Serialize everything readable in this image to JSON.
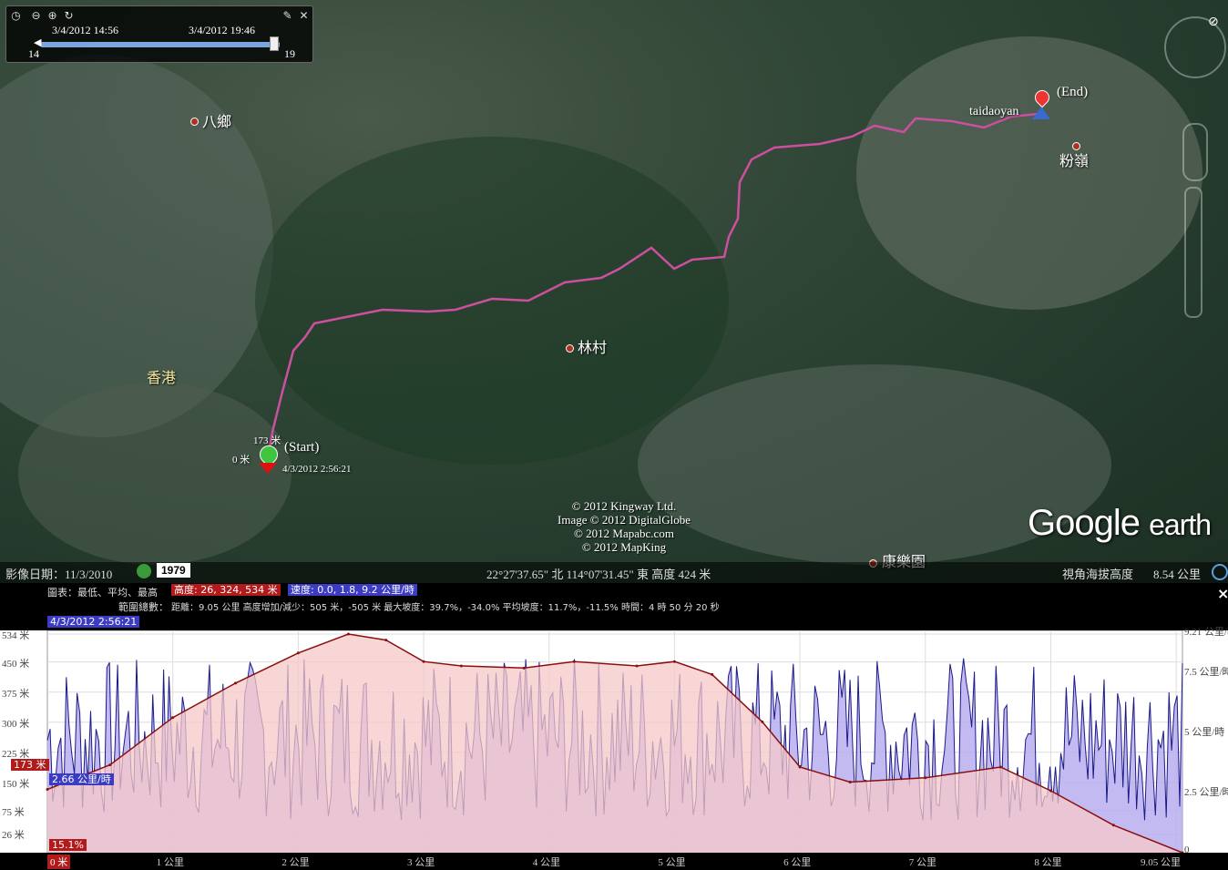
{
  "time_slider": {
    "start_label": "3/4/2012  14:56",
    "end_label": "3/4/2012  19:46",
    "min_hour": "14",
    "max_hour": "19"
  },
  "map": {
    "places": [
      "八鄉",
      "林村",
      "香港",
      "粉嶺",
      "康樂園"
    ],
    "track_start_label": "(Start)",
    "track_end_label": "(End)",
    "end_name": "taidaoyan",
    "start_altitude": "173 米",
    "start_ground": "0 米",
    "start_time": "4/3/2012 2:56:21",
    "copyright": [
      "© 2012 Kingway Ltd.",
      "Image © 2012 DigitalGlobe",
      "© 2012 Mapabc.com",
      "© 2012 MapKing"
    ],
    "logo_google": "Google",
    "logo_earth": "earth"
  },
  "status": {
    "imagery_date": "影像日期：11/3/2010",
    "year": "1979",
    "coords": "22°27'37.65\" 北  114°07'31.45\" 東 高度   424 米",
    "eye_alt_label": "視角海拔高度",
    "eye_alt_value": "8.54 公里"
  },
  "profile": {
    "legend_title": "圖表：最低、平均、最高",
    "elev_badge": "高度: 26, 324, 534 米",
    "speed_badge": "速度: 0.0, 1.8, 9.2 公里/時",
    "range_label": "範圍總數：",
    "range_stats": "距離：9.05 公里 高度增加/減少：505 米，-505 米  最大坡度：39.7%，-34.0%  平均坡度：11.7%，-11.5%  時間：4 時 50 分 20 秒",
    "cursor_time": "4/3/2012 2:56:21",
    "cursor_elev": "173 米",
    "cursor_speed": "2.66 公里/時",
    "cursor_slope": "15.1%",
    "close": "×",
    "y_left_ticks": [
      "534 米",
      "450 米",
      "375 米",
      "300 米",
      "225 米",
      "150 米",
      "75 米",
      "26 米"
    ],
    "y_right_ticks": [
      "9.21 公里/時",
      "7.5 公里/時",
      "5 公里/時",
      "2.5 公里/時",
      "0"
    ],
    "x_ticks": [
      "0 米",
      "1 公里",
      "2 公里",
      "3 公里",
      "4 公里",
      "5 公里",
      "6 公里",
      "7 公里",
      "8 公里",
      "9.05 公里"
    ]
  },
  "chart_data": {
    "type": "area",
    "series": [
      {
        "name": "高度",
        "x_km": [
          0,
          0.5,
          1.0,
          1.5,
          2.0,
          2.4,
          2.7,
          3.0,
          3.3,
          3.8,
          4.2,
          4.7,
          5.0,
          5.3,
          5.7,
          6.0,
          6.4,
          7.0,
          7.6,
          8.0,
          8.5,
          9.05
        ],
        "values": [
          173,
          230,
          340,
          420,
          490,
          534,
          520,
          470,
          460,
          455,
          470,
          460,
          470,
          440,
          330,
          225,
          190,
          200,
          225,
          170,
          90,
          26
        ]
      },
      {
        "name": "速度",
        "unit": "公里/時",
        "range": [
          0.0,
          9.2
        ]
      }
    ],
    "xlabel": "",
    "ylabel": "",
    "ylim_elev": [
      26,
      534
    ],
    "ylim_speed": [
      0,
      9.21
    ],
    "xlim": [
      0,
      9.05
    ]
  },
  "colors": {
    "track": "#cc4fa0",
    "elev_fill": "#f7c8c8",
    "elev_line": "#8a1010",
    "speed_fill": "#b8aef0",
    "speed_line": "#1a1a8a",
    "elev_badge_bg": "#b11b1b",
    "speed_badge_bg": "#3b3bc4"
  }
}
